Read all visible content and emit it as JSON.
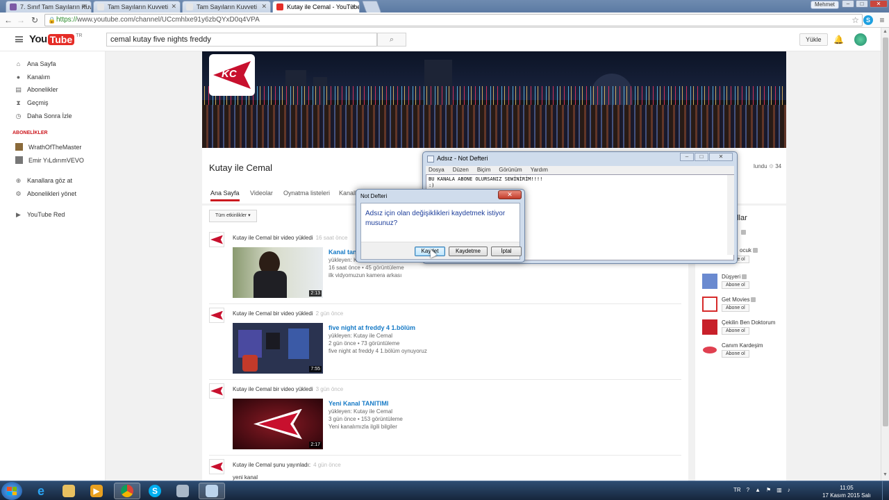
{
  "browser": {
    "tabs": [
      {
        "label": "7. Sınıf Tam Sayıların Kuvv",
        "color": "#7d5aa6"
      },
      {
        "label": "Tam Sayıların Kuvveti",
        "color": ""
      },
      {
        "label": "Tam Sayıların Kuvveti",
        "color": ""
      },
      {
        "label": "Kutay ile Cemal - YouTube",
        "color": "#e52d27"
      }
    ],
    "user": "Mehmet",
    "url_scheme": "https://",
    "url_rest": "www.youtube.com/channel/UCcmhlxe91y6zbQYxD0q4VPA"
  },
  "youtube": {
    "logo_you": "You",
    "logo_tube": "Tube",
    "logo_region": "TR",
    "search_value": "cemal kutay five nights freddy",
    "upload_label": "Yükle"
  },
  "guide": {
    "items": [
      {
        "label": "Ana Sayfa",
        "icon": "⌂"
      },
      {
        "label": "Kanalım",
        "icon": "●"
      },
      {
        "label": "Abonelikler",
        "icon": "▤"
      },
      {
        "label": "Geçmiş",
        "icon": "⧗"
      },
      {
        "label": "Daha Sonra İzle",
        "icon": "◷"
      }
    ],
    "section_title": "ABONELİKLER",
    "subscriptions": [
      {
        "label": "WrathOfTheMaster",
        "color": "#8a6a3a"
      },
      {
        "label": "Emir YıLdırımVEVO",
        "color": "#777777"
      }
    ],
    "bottom_items": [
      {
        "label": "Kanallara göz at",
        "icon": "⊕"
      },
      {
        "label": "Abonelikleri yönet",
        "icon": "⚙"
      },
      {
        "label": "YouTube Red",
        "icon": "▶"
      }
    ]
  },
  "channel": {
    "title": "Kutay ile Cemal",
    "tabs": [
      "Ana Sayfa",
      "Videolar",
      "Oynatma listeleri",
      "Kanall"
    ],
    "subscribed_fragment": "lundu",
    "subscriber_count": "34",
    "filter_label": "Tüm etkinlikler",
    "activities": [
      {
        "line": "Kutay ile Cemal bir video yükledi",
        "when": "16 saat önce",
        "title": "Kanal tan",
        "uploader": "yükleyen: K",
        "stats": "16 saat önce • 45 görüntüleme",
        "desc": "ilk vidyomuzun kamera arkası",
        "duration": "2:13"
      },
      {
        "line": "Kutay ile Cemal bir video yükledi",
        "when": "2 gün önce",
        "title": "five night at freddy 4 1.bölüm",
        "uploader": "yükleyen: Kutay ile Cemal",
        "stats": "2 gün önce • 73 görüntüleme",
        "desc": "five night at freddy 4 1.bölüm oynuyoruz",
        "duration": "7:55"
      },
      {
        "line": "Kutay ile Cemal bir video yükledi",
        "when": "3 gün önce",
        "title": "Yeni Kanal TANITIMI",
        "uploader": "yükleyen: Kutay ile Cemal",
        "stats": "3 gün önce • 153 görüntüleme",
        "desc": "Yeni kanalımızla ilgili bilgiler",
        "duration": "2:17"
      }
    ],
    "last_activity": {
      "line": "Kutay ile Cemal şunu yayınladı:",
      "when": "4 gün önce",
      "text": "yeni kanal"
    }
  },
  "right_column": {
    "title_fragment": "allar",
    "channels": [
      {
        "name": "ocuk",
        "sub": "",
        "color": "#f0a030"
      },
      {
        "name": "Düşyeri",
        "sub": "Abone ol",
        "color": "#6a8ad0"
      },
      {
        "name": "Get Movies",
        "sub": "Abone ol",
        "color": "#d62a2a"
      },
      {
        "name": "Çekilin Ben Doktorum",
        "sub": "Abone ol",
        "color": "#c8202a"
      },
      {
        "name": "Canım Kardeşim",
        "sub": "Abone ol",
        "color": "#e04050"
      }
    ]
  },
  "notepad": {
    "title": "Adsız - Not Defteri",
    "menu": [
      "Dosya",
      "Düzen",
      "Biçim",
      "Görünüm",
      "Yardım"
    ],
    "text": "BU KANALA ABONE OLURSANIZ SEWİNİRİM!!!!\n:)"
  },
  "dialog": {
    "title": "Not Defteri",
    "message": "Adsız için olan değişiklikleri kaydetmek istiyor musunuz?",
    "save_label": "Kaydet",
    "dont_save_label": "Kaydetme",
    "cancel_label": "İptal"
  },
  "taskbar": {
    "language": "TR",
    "time": "11:05",
    "date": "17 Kasım 2015 Salı"
  }
}
